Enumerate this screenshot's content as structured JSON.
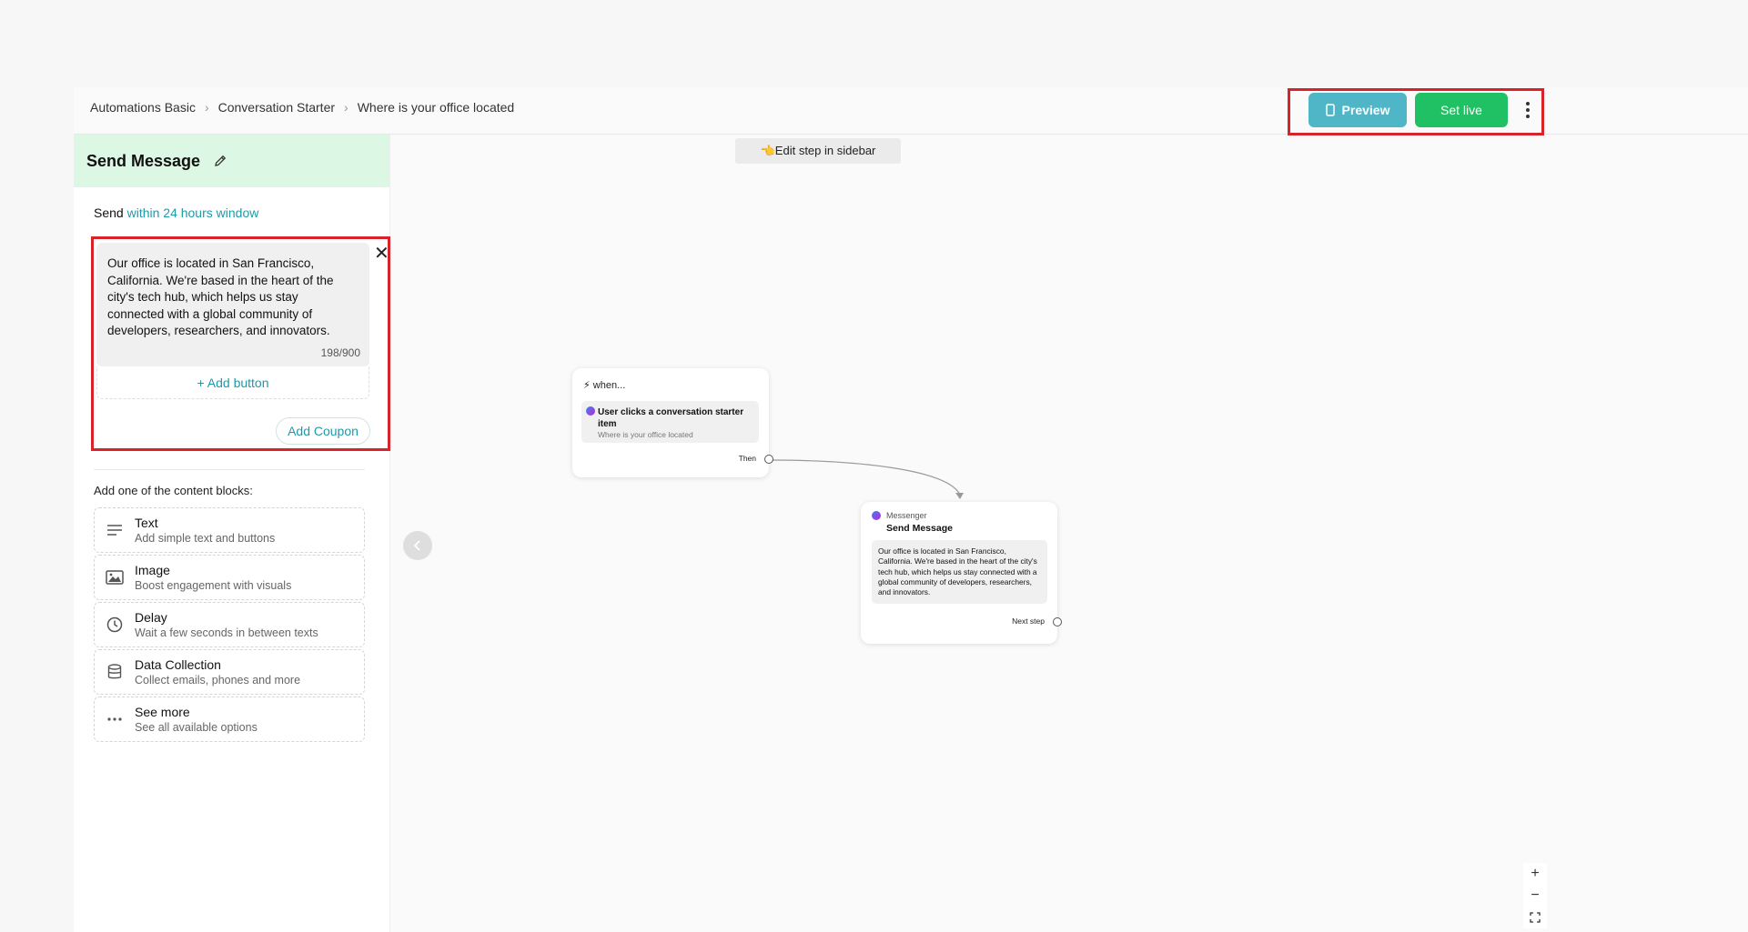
{
  "breadcrumb": [
    "Automations Basic",
    "Conversation Starter",
    "Where is your office located"
  ],
  "header": {
    "preview_label": "Preview",
    "set_live_label": "Set live"
  },
  "sidebar": {
    "title": "Send Message",
    "send_prefix": "Send",
    "send_window": "within 24 hours window",
    "message_text": "Our office is located in San Francisco, California. We're based in the heart of the city's tech hub, which helps us stay connected with a global community of developers, researchers, and innovators.",
    "char_count": "198/900",
    "add_button_label": "+ Add button",
    "add_coupon_label": "Add Coupon",
    "blocks_heading": "Add one of the content blocks:",
    "blocks": [
      {
        "title": "Text",
        "subtitle": "Add simple text and buttons",
        "icon": "text-lines-icon"
      },
      {
        "title": "Image",
        "subtitle": "Boost engagement with visuals",
        "icon": "image-icon"
      },
      {
        "title": "Delay",
        "subtitle": "Wait a few seconds in between texts",
        "icon": "clock-icon"
      },
      {
        "title": "Data Collection",
        "subtitle": "Collect emails, phones and more",
        "icon": "database-icon"
      },
      {
        "title": "See more",
        "subtitle": "See all available options",
        "icon": "more-dots-icon"
      }
    ]
  },
  "canvas": {
    "hint": "👈Edit step in sidebar",
    "trigger_node": {
      "when_label": "when...",
      "title": "User clicks a conversation starter item",
      "subtitle": "Where is your office located",
      "then_label": "Then"
    },
    "message_node": {
      "channel": "Messenger",
      "title": "Send Message",
      "body": "Our office is located in San Francisco, California. We're based in the heart of the city's tech hub, which helps us stay connected with a global community of developers, researchers, and innovators.",
      "next_label": "Next step"
    }
  },
  "colors": {
    "accent": "#1e9aa8",
    "preview": "#4fb6c8",
    "set_live": "#20c164",
    "highlight": "#d9232a",
    "sidebar_header": "#dcf7e3"
  }
}
